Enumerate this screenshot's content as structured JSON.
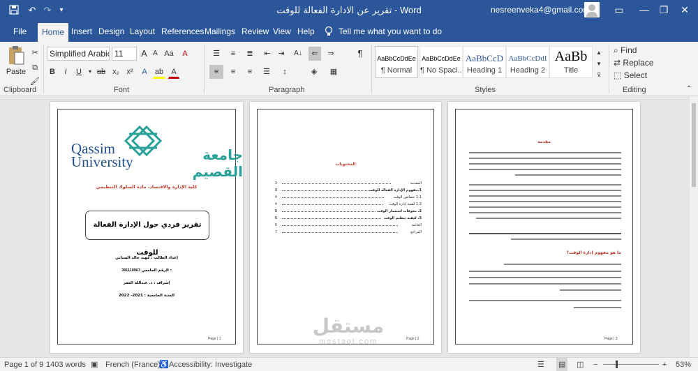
{
  "app": {
    "name": "Word",
    "document_title": "تقرير عن الادارة الفعالة للوقت",
    "title_separator": " - ",
    "account_email": "nesreenveka4@gmail.com"
  },
  "window_controls": {
    "ribbon_display": "▭",
    "minimize": "—",
    "restore": "❐",
    "close": "✕"
  },
  "quick_access": {
    "save_icon": "save-icon",
    "undo_icon": "undo-icon",
    "redo_icon": "redo-icon"
  },
  "menu": {
    "tabs": [
      "File",
      "Home",
      "Insert",
      "Design",
      "Layout",
      "References",
      "Mailings",
      "Review",
      "View",
      "Help"
    ],
    "active_tab": "Home",
    "tell_me": "Tell me what you want to do"
  },
  "ribbon": {
    "clipboard": {
      "paste": "Paste",
      "label": "Clipboard"
    },
    "font": {
      "family": "Simplified Arabic",
      "size": "11",
      "label": "Font",
      "bold": "B",
      "italic": "I",
      "underline": "U",
      "grow": "A",
      "shrink": "A",
      "case": "Aa",
      "clear": "A",
      "subscript": "x₂",
      "superscript": "x²",
      "effects": "A",
      "highlight": "ab",
      "color": "A"
    },
    "paragraph": {
      "label": "Paragraph",
      "pilcrow": "¶",
      "sort": "A↓"
    },
    "styles": {
      "label": "Styles",
      "items": [
        {
          "sample": "AaBbCcDdEe",
          "name": "¶ Normal"
        },
        {
          "sample": "AaBbCcDdEe",
          "name": "¶ No Spaci..."
        },
        {
          "sample": "AaBbCcD",
          "name": "Heading 1"
        },
        {
          "sample": "AaBbCcDdI",
          "name": "Heading 2"
        },
        {
          "sample": "AaBb",
          "name": "Title"
        }
      ]
    },
    "editing": {
      "find": "Find",
      "replace": "Replace",
      "select": "Select",
      "label": "Editing"
    }
  },
  "pages": {
    "cover": {
      "logo_en_line1": "Qassim",
      "logo_en_line2": "University",
      "logo_ar": "جامعة القصيم",
      "college": "كلية الإدارة والاقتصاد، مادة السلوك التنظيمي",
      "report_title": "تقرير فردي حول الإدارة الفعالة للوقت",
      "student": "إعداد الطالب : مهند خالد السناني",
      "university_id_label": "الرقم الجامعي :",
      "university_id": "391110967",
      "supervisor": "إشراف : د. عبدالله العمر",
      "year": "السنة الجامعية : 2021- 2022",
      "page_label": "Page | 1"
    },
    "toc": {
      "heading": "المحتويات",
      "rows": [
        {
          "title": "المقدمة",
          "page": "3"
        },
        {
          "title": "1.مفهوم الإدارة الفعالة للوقت",
          "page": "3"
        },
        {
          "title": "1.1 خصائص الوقت",
          "page": "4"
        },
        {
          "title": "1.2 أهمية إدارة الوقت",
          "page": "4"
        },
        {
          "title": "2. معوقات استثمار الوقت",
          "page": "5"
        },
        {
          "title": "3. كيفية تنظيم الوقت",
          "page": "5"
        },
        {
          "title": "الخاتمة",
          "page": "6"
        },
        {
          "title": "المراجع",
          "page": "7"
        }
      ],
      "page_label": "Page | 2"
    },
    "intro": {
      "heading": "مقدمة",
      "section_heading": "ما هو مفهوم إدارة الوقت؟",
      "page_label": "Page | 3"
    }
  },
  "statusbar": {
    "page": "Page 1 of 9",
    "words": "1403 words",
    "language": "French (France)",
    "accessibility": "Accessibility: Investigate",
    "zoom": "53%",
    "zoom_level": 0.53
  },
  "watermark": {
    "ar": "مستقل",
    "en": "mostaql.com"
  },
  "colors": {
    "brand": "#2b579a",
    "logo_blue": "#1f4e8c",
    "logo_teal": "#2aa198",
    "heading_red": "#c0392b"
  }
}
